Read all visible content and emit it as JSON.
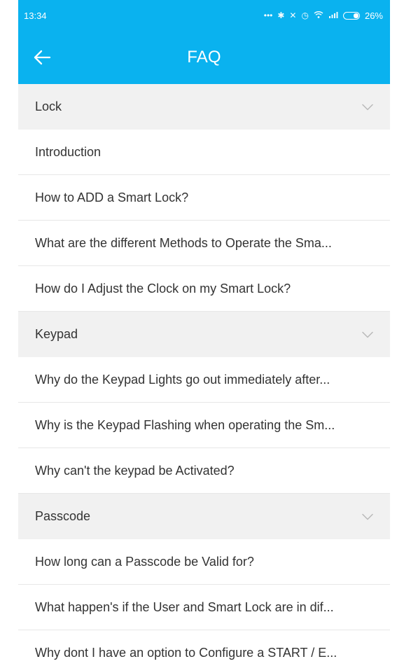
{
  "theme": {
    "accent": "#0ab2ef"
  },
  "status_bar": {
    "time": "13:34",
    "icons": [
      "more-dots-icon",
      "bluetooth-icon",
      "mute-icon",
      "alarm-icon",
      "wifi-icon",
      "signal-icon",
      "battery-icon"
    ],
    "battery_percent": "26%"
  },
  "header": {
    "title": "FAQ",
    "back_icon": "arrow-left-icon"
  },
  "faq": [
    {
      "category": "Lock",
      "questions": [
        "Introduction",
        "How to ADD a Smart Lock?",
        "What are the different Methods to Operate the Sma...",
        "How do I Adjust the Clock on my Smart Lock?"
      ]
    },
    {
      "category": "Keypad",
      "questions": [
        "Why do the Keypad Lights go out immediately after...",
        "Why is the Keypad Flashing when operating the Sm...",
        "Why can't the keypad be Activated?"
      ]
    },
    {
      "category": "Passcode",
      "questions": [
        "How long can a Passcode be Valid for?",
        "What happen's if the User and Smart Lock are in dif...",
        "Why dont I have an option to Configure a START / E..."
      ]
    }
  ]
}
